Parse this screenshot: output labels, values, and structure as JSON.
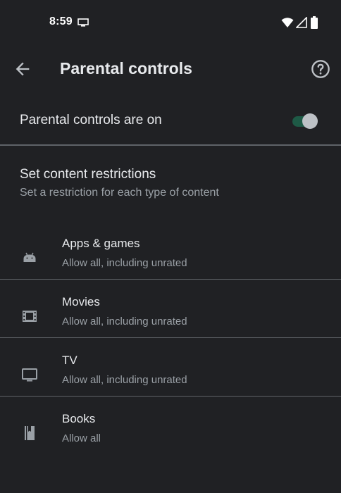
{
  "status_bar": {
    "time": "8:59",
    "icons": [
      "cast-icon",
      "wifi-icon",
      "signal-icon",
      "battery-icon"
    ]
  },
  "app_bar": {
    "back_icon": "arrow-back-icon",
    "title": "Parental controls",
    "help_icon": "help-circle-icon"
  },
  "master_toggle": {
    "label": "Parental controls are on",
    "state": "on",
    "accent_color": "#1e5a46"
  },
  "restrictions": {
    "title": "Set content restrictions",
    "subtitle": "Set a restriction for each type of content",
    "items": [
      {
        "icon": "android-icon",
        "title": "Apps & games",
        "subtitle": "Allow all, including unrated"
      },
      {
        "icon": "film-icon",
        "title": "Movies",
        "subtitle": "Allow all, including unrated"
      },
      {
        "icon": "tv-icon",
        "title": "TV",
        "subtitle": "Allow all, including unrated"
      },
      {
        "icon": "book-icon",
        "title": "Books",
        "subtitle": "Allow all"
      }
    ]
  },
  "colors": {
    "background": "#202124",
    "primary_text": "#e8eaed",
    "secondary_text": "#9aa0a6",
    "divider": "#5f6368"
  }
}
